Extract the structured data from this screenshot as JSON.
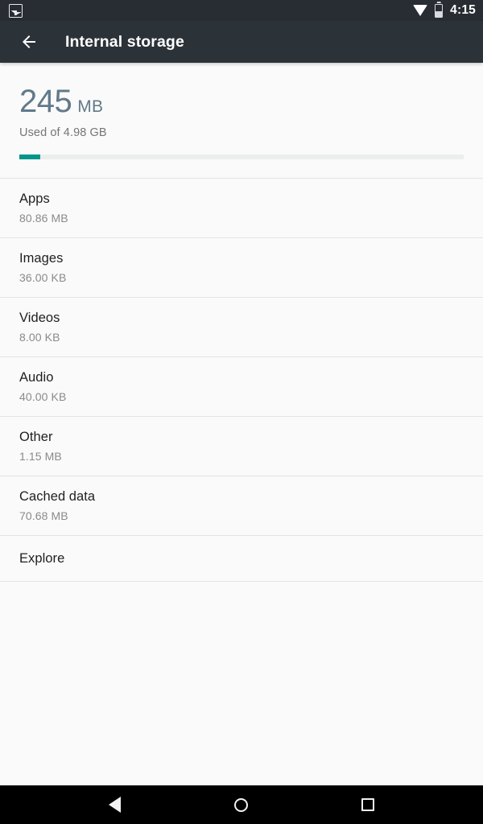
{
  "status_bar": {
    "notification_icon": "image-notification-icon",
    "wifi_icon": "wifi-icon",
    "battery_icon": "battery-icon",
    "clock": "4:15"
  },
  "app_bar": {
    "back_icon": "back-arrow-icon",
    "title": "Internal storage"
  },
  "summary": {
    "value": "245",
    "unit": "MB",
    "caption": "Used of 4.98 GB",
    "used_percent": 4.8,
    "accent_color": "#009688",
    "value_color": "#62798a"
  },
  "storage_items": [
    {
      "title": "Apps",
      "size": "80.86 MB"
    },
    {
      "title": "Images",
      "size": "36.00 KB"
    },
    {
      "title": "Videos",
      "size": "8.00 KB"
    },
    {
      "title": "Audio",
      "size": "40.00 KB"
    },
    {
      "title": "Other",
      "size": "1.15 MB"
    },
    {
      "title": "Cached data",
      "size": "70.68 MB"
    },
    {
      "title": "Explore",
      "size": ""
    }
  ],
  "nav_bar": {
    "back": "back-triangle-icon",
    "home": "home-circle-icon",
    "recents": "recents-square-icon"
  }
}
